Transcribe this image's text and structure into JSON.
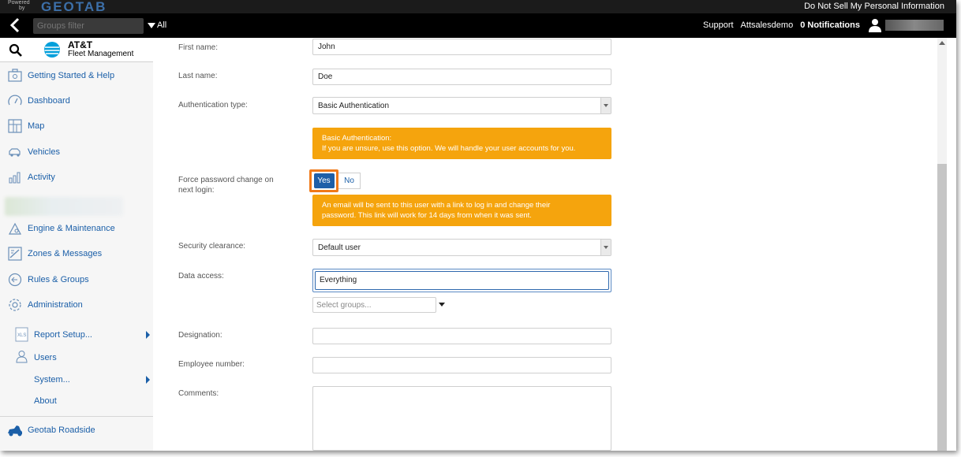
{
  "topstrip": {
    "powered": "Powered",
    "by": "by",
    "logo": "GEOTAB",
    "do_not_sell": "Do Not Sell My Personal Information"
  },
  "header": {
    "groups_filter_placeholder": "Groups filter",
    "all_label": "All",
    "support": "Support",
    "account": "Attsalesdemo",
    "notifications": "0 Notifications"
  },
  "brand": {
    "line1": "AT&T",
    "line2": "Fleet Management"
  },
  "sidebar": {
    "items": [
      {
        "label": "Getting Started & Help",
        "icon": "help-icon"
      },
      {
        "label": "Dashboard",
        "icon": "dashboard-icon"
      },
      {
        "label": "Map",
        "icon": "map-icon"
      },
      {
        "label": "Vehicles",
        "icon": "vehicle-icon"
      },
      {
        "label": "Activity",
        "icon": "activity-icon"
      },
      {
        "label": "Engine & Maintenance",
        "icon": "engine-icon"
      },
      {
        "label": "Zones & Messages",
        "icon": "zones-icon"
      },
      {
        "label": "Rules & Groups",
        "icon": "rules-icon"
      },
      {
        "label": "Administration",
        "icon": "gear-icon"
      }
    ],
    "sub_items": [
      {
        "label": "Report Setup...",
        "icon": "xls-icon",
        "has_arrow": true
      },
      {
        "label": "Users",
        "icon": "user-icon",
        "has_arrow": false
      },
      {
        "label": "System...",
        "has_arrow": true
      },
      {
        "label": "About",
        "has_arrow": false
      }
    ],
    "roadside": {
      "label": "Geotab Roadside",
      "icon": "roadside-icon"
    }
  },
  "form": {
    "first_name_label": "First name:",
    "first_name_value": "John",
    "last_name_label": "Last name:",
    "last_name_value": "Doe",
    "auth_type_label": "Authentication type:",
    "auth_type_value": "Basic Authentication",
    "auth_info_line1": "Basic Authentication:",
    "auth_info_line2": "If you are unsure, use this option. We will handle your user accounts for you.",
    "force_pw_label_line1": "Force password change on",
    "force_pw_label_line2": "next login:",
    "yes_label": "Yes",
    "no_label": "No",
    "force_pw_info_line1": "An email will be sent to this user with a link to log in and change their",
    "force_pw_info_line2": "password. This link will work for 14 days from when it was sent.",
    "security_label": "Security clearance:",
    "security_value": "Default user",
    "data_access_label": "Data access:",
    "data_access_value": "Everything",
    "select_groups_placeholder": "Select groups...",
    "designation_label": "Designation:",
    "employee_number_label": "Employee number:",
    "comments_label": "Comments:"
  },
  "colors": {
    "link": "#1b5fa8",
    "warning": "#f5a40d",
    "highlight": "#f07a1a",
    "selected": "#1e5fa8"
  }
}
